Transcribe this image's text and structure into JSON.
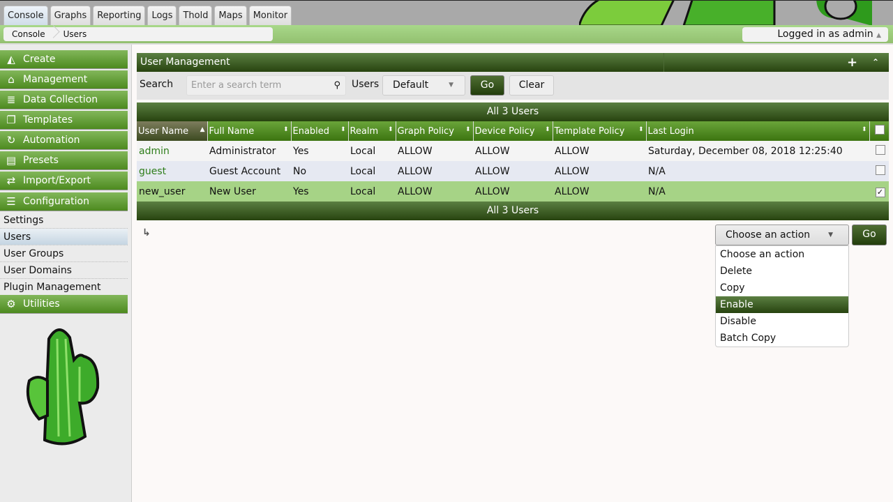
{
  "tabs": [
    "Console",
    "Graphs",
    "Reporting",
    "Logs",
    "Thold",
    "Maps",
    "Monitor"
  ],
  "breadcrumb": [
    "Console",
    "Users"
  ],
  "logged_in": "Logged in as admin",
  "sidebar": {
    "menus": [
      {
        "label": "Create",
        "icon": "chart-area-icon"
      },
      {
        "label": "Management",
        "icon": "home-icon"
      },
      {
        "label": "Data Collection",
        "icon": "database-icon"
      },
      {
        "label": "Templates",
        "icon": "copy-icon"
      },
      {
        "label": "Automation",
        "icon": "refresh-icon"
      },
      {
        "label": "Presets",
        "icon": "archive-icon"
      },
      {
        "label": "Import/Export",
        "icon": "exchange-icon"
      },
      {
        "label": "Configuration",
        "icon": "sliders-icon"
      }
    ],
    "sub": [
      "Settings",
      "Users",
      "User Groups",
      "User Domains",
      "Plugin Management"
    ],
    "utilities": "Utilities"
  },
  "panel": {
    "title": "User Management"
  },
  "filter": {
    "search_label": "Search",
    "search_placeholder": "Enter a search term",
    "users_label": "Users",
    "users_value": "Default",
    "go": "Go",
    "clear": "Clear"
  },
  "table": {
    "caption": "All 3 Users",
    "columns": [
      "User Name",
      "Full Name",
      "Enabled",
      "Realm",
      "Graph Policy",
      "Device Policy",
      "Template Policy",
      "Last Login"
    ],
    "rows": [
      {
        "c": [
          "admin",
          "Administrator",
          "Yes",
          "Local",
          "ALLOW",
          "ALLOW",
          "ALLOW",
          "Saturday, December 08, 2018 12:25:40"
        ],
        "checked": false
      },
      {
        "c": [
          "guest",
          "Guest Account",
          "No",
          "Local",
          "ALLOW",
          "ALLOW",
          "ALLOW",
          "N/A"
        ],
        "checked": false
      },
      {
        "c": [
          "new_user",
          "New User",
          "Yes",
          "Local",
          "ALLOW",
          "ALLOW",
          "ALLOW",
          "N/A"
        ],
        "checked": true
      }
    ]
  },
  "action": {
    "selected": "Choose an action",
    "go": "Go",
    "options": [
      "Choose an action",
      "Delete",
      "Copy",
      "Enable",
      "Disable",
      "Batch Copy"
    ],
    "highlighted": "Enable"
  }
}
